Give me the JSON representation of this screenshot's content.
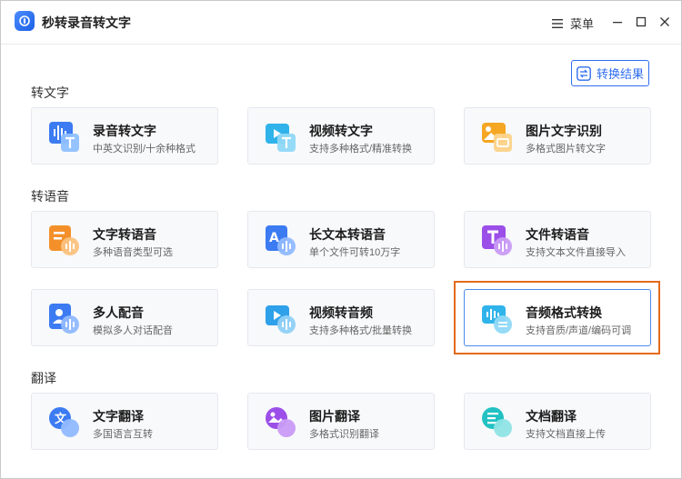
{
  "app": {
    "title": "秒转录音转文字",
    "menu_label": "菜单"
  },
  "toolbar": {
    "result_label": "转换结果"
  },
  "colors": {
    "accent": "#2f6df0",
    "highlight": "#e46a1c"
  },
  "sections": [
    {
      "title": "转文字",
      "cards": [
        {
          "title": "录音转文字",
          "desc": "中英文识别/十余种格式",
          "icon": "audio-to-text-icon"
        },
        {
          "title": "视频转文字",
          "desc": "支持多种格式/精准转换",
          "icon": "video-to-text-icon"
        },
        {
          "title": "图片文字识别",
          "desc": "多格式图片转文字",
          "icon": "image-ocr-icon"
        }
      ]
    },
    {
      "title": "转语音",
      "cards": [
        {
          "title": "文字转语音",
          "desc": "多种语音类型可选",
          "icon": "text-to-speech-icon"
        },
        {
          "title": "长文本转语音",
          "desc": "单个文件可转10万字",
          "icon": "long-text-to-speech-icon"
        },
        {
          "title": "文件转语音",
          "desc": "支持文本文件直接导入",
          "icon": "file-to-speech-icon"
        },
        {
          "title": "多人配音",
          "desc": "模拟多人对话配音",
          "icon": "multi-voice-dubbing-icon"
        },
        {
          "title": "视频转音频",
          "desc": "支持多种格式/批量转换",
          "icon": "video-to-audio-icon"
        },
        {
          "title": "音频格式转换",
          "desc": "支持音质/声道/编码可调",
          "icon": "audio-format-convert-icon"
        }
      ]
    },
    {
      "title": "翻译",
      "cards": [
        {
          "title": "文字翻译",
          "desc": "多国语言互转",
          "icon": "text-translate-icon"
        },
        {
          "title": "图片翻译",
          "desc": "多格式识别翻译",
          "icon": "image-translate-icon"
        },
        {
          "title": "文档翻译",
          "desc": "支持文档直接上传",
          "icon": "document-translate-icon"
        }
      ]
    }
  ]
}
